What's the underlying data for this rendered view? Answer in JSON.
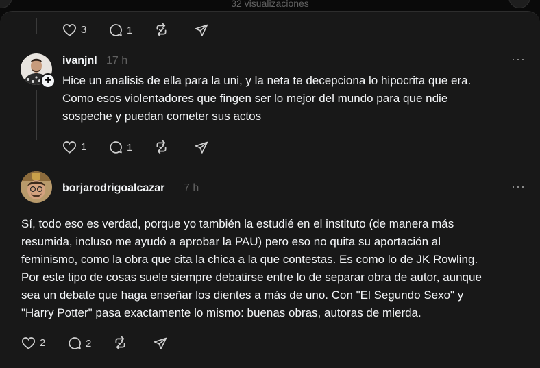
{
  "header": {
    "views": "32 visualizaciones"
  },
  "posts": [
    {
      "actions": {
        "likes": "3",
        "replies": "1"
      }
    },
    {
      "username": "ivanjnl",
      "time": "17 h",
      "more": "···",
      "lines": [
        "Hice un analisis de ella para la uni, y la neta te decepciona lo hipocrita que era.",
        "Como esos violentadores que fingen ser lo mejor del mundo para que ndie",
        "sospeche y puedan cometer sus actos"
      ],
      "actions": {
        "likes": "1",
        "replies": "1"
      }
    },
    {
      "username": "borjarodrigoalcazar",
      "time": "7 h",
      "more": "···",
      "lines": [
        "Sí, todo eso es verdad, porque yo también la estudié en el instituto (de manera más",
        "resumida, incluso me ayudó a aprobar la PAU) pero eso no quita su aportación al",
        "feminismo, como la obra que cita la chica a la que contestas. Es como lo de JK Rowling.",
        "Por este tipo de cosas suele siempre debatirse entre lo de separar obra de autor, aunque",
        "sea un debate que haga enseñar los dientes a más de uno. Con \"El Segundo Sexo\" y",
        "\"Harry Potter\" pasa exactamente lo mismo: buenas obras, autoras de mierda."
      ],
      "actions": {
        "likes": "2",
        "replies": "2"
      }
    }
  ],
  "icons": {
    "like": "heart-icon",
    "reply": "comment-icon",
    "repost": "repost-icon",
    "share": "send-icon",
    "follow": "plus-icon"
  },
  "colors": {
    "background": "#181818",
    "text": "#f3f5f7",
    "muted": "#616161"
  }
}
